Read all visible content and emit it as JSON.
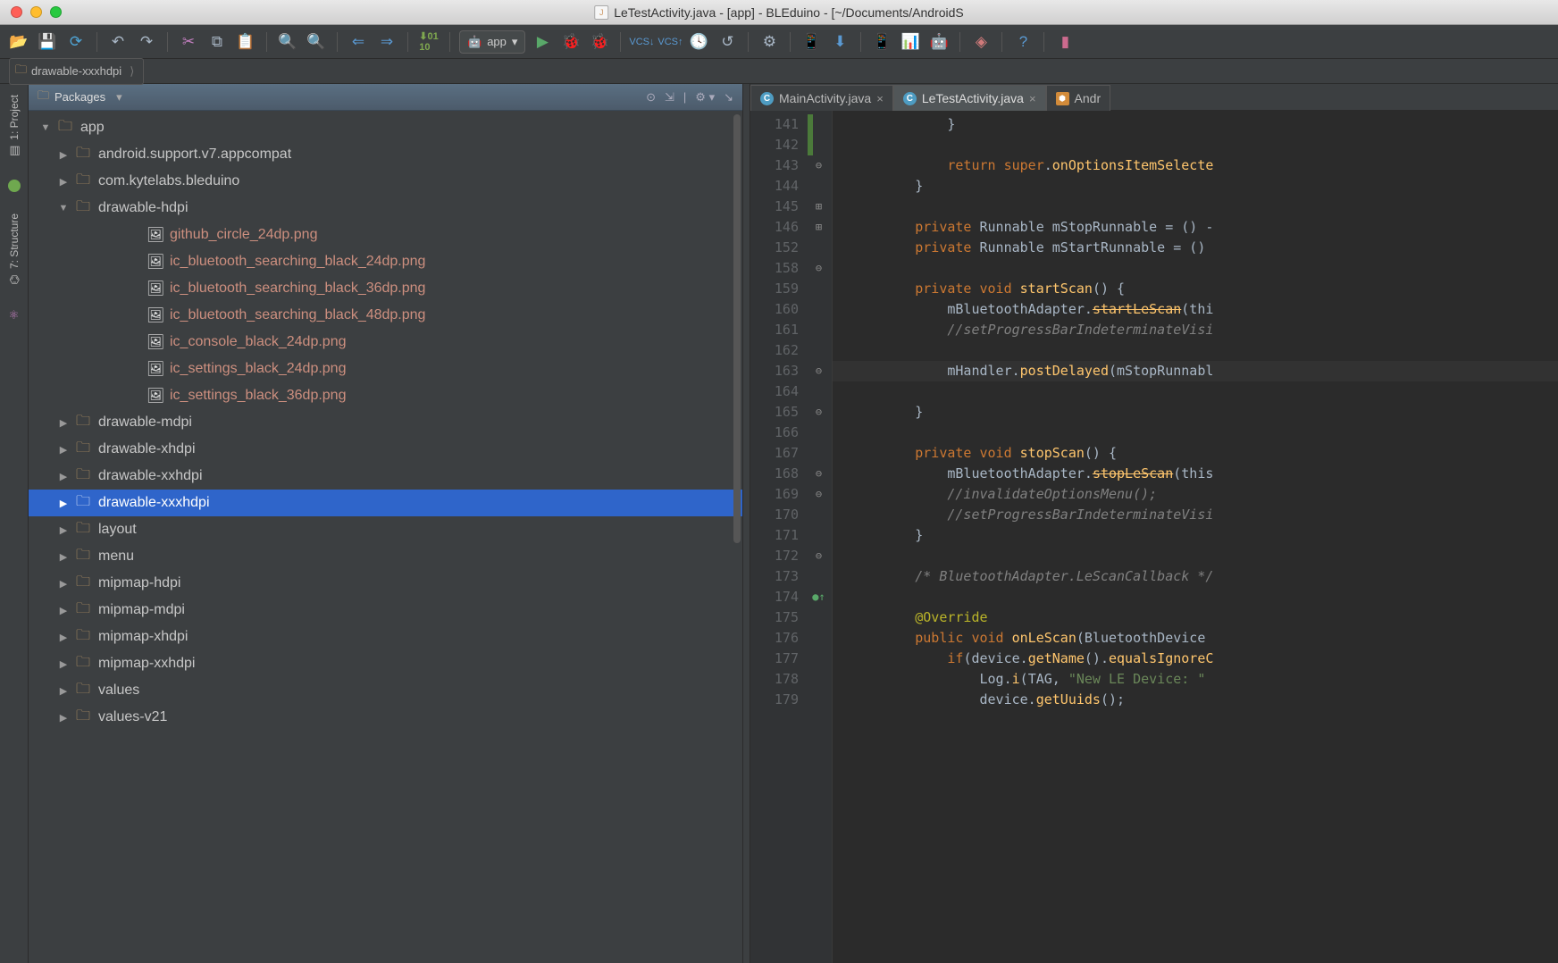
{
  "window": {
    "title": "LeTestActivity.java - [app] - BLEduino - [~/Documents/AndroidS"
  },
  "toolbar": {
    "run_config": "app"
  },
  "breadcrumb": {
    "item": "drawable-xxxhdpi"
  },
  "sidebar": {
    "tabs": [
      "1: Project",
      "7: Structure"
    ]
  },
  "project_panel": {
    "title": "Packages"
  },
  "tree": {
    "root": "app",
    "pkg1": "android.support.v7.appcompat",
    "pkg2": "com.kytelabs.bleduino",
    "folder_dh": "drawable-hdpi",
    "files_dh": [
      "github_circle_24dp.png",
      "ic_bluetooth_searching_black_24dp.png",
      "ic_bluetooth_searching_black_36dp.png",
      "ic_bluetooth_searching_black_48dp.png",
      "ic_console_black_24dp.png",
      "ic_settings_black_24dp.png",
      "ic_settings_black_36dp.png"
    ],
    "folders_rest": [
      "drawable-mdpi",
      "drawable-xhdpi",
      "drawable-xxhdpi",
      "drawable-xxxhdpi",
      "layout",
      "menu",
      "mipmap-hdpi",
      "mipmap-mdpi",
      "mipmap-xhdpi",
      "mipmap-xxhdpi",
      "values",
      "values-v21"
    ],
    "selected": "drawable-xxxhdpi"
  },
  "tabs": {
    "t0": "MainActivity.java",
    "t1": "LeTestActivity.java",
    "t2": "Andr"
  },
  "code": {
    "line_numbers": [
      141,
      142,
      143,
      144,
      145,
      146,
      152,
      158,
      159,
      160,
      161,
      162,
      163,
      164,
      165,
      166,
      167,
      168,
      169,
      170,
      171,
      172,
      173,
      174,
      175,
      176,
      177,
      178,
      179
    ],
    "folded_bar_idx": 1,
    "highlighted_idx": 12,
    "anno": {
      "plus_idx": [
        5,
        6
      ],
      "close_idx": [
        3,
        8,
        13,
        15,
        18,
        19,
        22
      ],
      "override_idx": 24
    },
    "lines": [
      "            }",
      "",
      "            return super.onOptionsItemSelecte",
      "        }",
      "",
      "        private Runnable mStopRunnable = () -",
      "        private Runnable mStartRunnable = ()",
      "",
      "        private void startScan() {",
      "            mBluetoothAdapter.startLeScan(thi",
      "            //setProgressBarIndeterminateVisi",
      "",
      "            mHandler.postDelayed(mStopRunnabl",
      "        }",
      "",
      "        private void stopScan() {",
      "            mBluetoothAdapter.stopLeScan(this",
      "            //invalidateOptionsMenu();",
      "            //setProgressBarIndeterminateVisi",
      "        }",
      "",
      "        /* BluetoothAdapter.LeScanCallback */",
      "",
      "        @Override",
      "        public void onLeScan(BluetoothDevice ",
      "            if(device.getName().equalsIgnoreC",
      "                Log.i(TAG, \"New LE Device: \" ",
      "                device.getUuids();",
      ""
    ]
  }
}
